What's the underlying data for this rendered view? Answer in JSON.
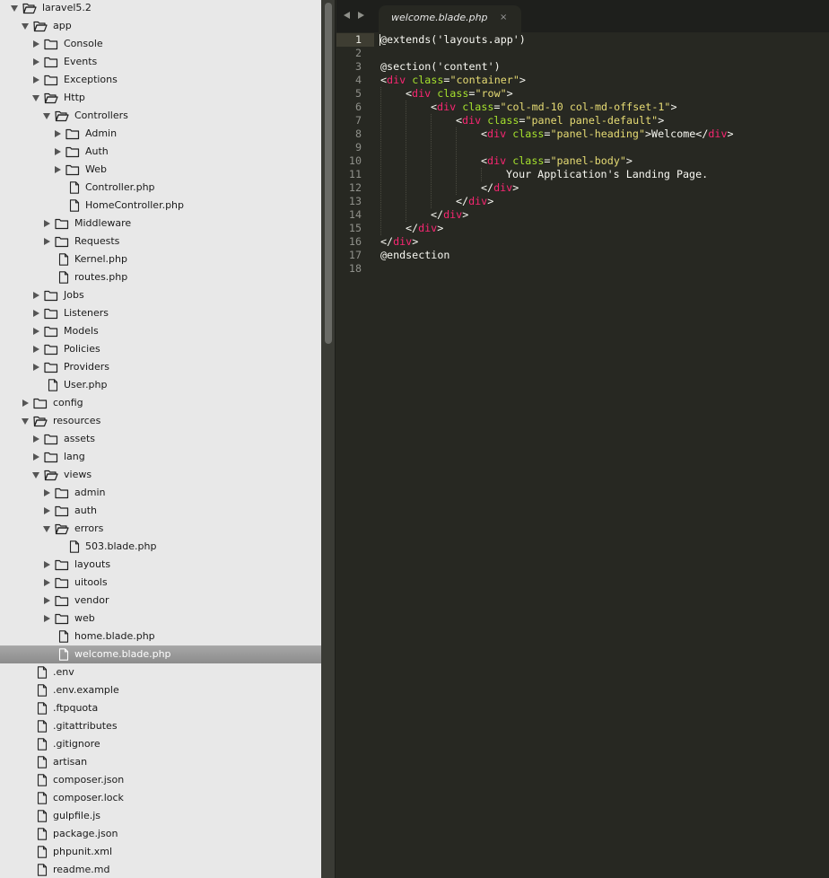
{
  "sidebar": {
    "items": [
      {
        "label": "laravel5.2",
        "depth": 0,
        "type": "folder",
        "open": true
      },
      {
        "label": "app",
        "depth": 1,
        "type": "folder",
        "open": true
      },
      {
        "label": "Console",
        "depth": 2,
        "type": "folder",
        "open": false
      },
      {
        "label": "Events",
        "depth": 2,
        "type": "folder",
        "open": false
      },
      {
        "label": "Exceptions",
        "depth": 2,
        "type": "folder",
        "open": false
      },
      {
        "label": "Http",
        "depth": 2,
        "type": "folder",
        "open": true
      },
      {
        "label": "Controllers",
        "depth": 3,
        "type": "folder",
        "open": true
      },
      {
        "label": "Admin",
        "depth": 4,
        "type": "folder",
        "open": false
      },
      {
        "label": "Auth",
        "depth": 4,
        "type": "folder",
        "open": false
      },
      {
        "label": "Web",
        "depth": 4,
        "type": "folder",
        "open": false
      },
      {
        "label": "Controller.php",
        "depth": 4,
        "type": "file"
      },
      {
        "label": "HomeController.php",
        "depth": 4,
        "type": "file"
      },
      {
        "label": "Middleware",
        "depth": 3,
        "type": "folder",
        "open": false
      },
      {
        "label": "Requests",
        "depth": 3,
        "type": "folder",
        "open": false
      },
      {
        "label": "Kernel.php",
        "depth": 3,
        "type": "file"
      },
      {
        "label": "routes.php",
        "depth": 3,
        "type": "file"
      },
      {
        "label": "Jobs",
        "depth": 2,
        "type": "folder",
        "open": false
      },
      {
        "label": "Listeners",
        "depth": 2,
        "type": "folder",
        "open": false
      },
      {
        "label": "Models",
        "depth": 2,
        "type": "folder",
        "open": false
      },
      {
        "label": "Policies",
        "depth": 2,
        "type": "folder",
        "open": false
      },
      {
        "label": "Providers",
        "depth": 2,
        "type": "folder",
        "open": false
      },
      {
        "label": "User.php",
        "depth": 2,
        "type": "file"
      },
      {
        "label": "config",
        "depth": 1,
        "type": "folder",
        "open": false
      },
      {
        "label": "resources",
        "depth": 1,
        "type": "folder",
        "open": true
      },
      {
        "label": "assets",
        "depth": 2,
        "type": "folder",
        "open": false
      },
      {
        "label": "lang",
        "depth": 2,
        "type": "folder",
        "open": false
      },
      {
        "label": "views",
        "depth": 2,
        "type": "folder",
        "open": true
      },
      {
        "label": "admin",
        "depth": 3,
        "type": "folder",
        "open": false
      },
      {
        "label": "auth",
        "depth": 3,
        "type": "folder",
        "open": false
      },
      {
        "label": "errors",
        "depth": 3,
        "type": "folder",
        "open": true
      },
      {
        "label": "503.blade.php",
        "depth": 4,
        "type": "file"
      },
      {
        "label": "layouts",
        "depth": 3,
        "type": "folder",
        "open": false
      },
      {
        "label": "uitools",
        "depth": 3,
        "type": "folder",
        "open": false
      },
      {
        "label": "vendor",
        "depth": 3,
        "type": "folder",
        "open": false
      },
      {
        "label": "web",
        "depth": 3,
        "type": "folder",
        "open": false
      },
      {
        "label": "home.blade.php",
        "depth": 3,
        "type": "file"
      },
      {
        "label": "welcome.blade.php",
        "depth": 3,
        "type": "file",
        "selected": true
      },
      {
        "label": ".env",
        "depth": 1,
        "type": "file"
      },
      {
        "label": ".env.example",
        "depth": 1,
        "type": "file"
      },
      {
        "label": ".ftpquota",
        "depth": 1,
        "type": "file"
      },
      {
        "label": ".gitattributes",
        "depth": 1,
        "type": "file"
      },
      {
        "label": ".gitignore",
        "depth": 1,
        "type": "file"
      },
      {
        "label": "artisan",
        "depth": 1,
        "type": "file"
      },
      {
        "label": "composer.json",
        "depth": 1,
        "type": "file"
      },
      {
        "label": "composer.lock",
        "depth": 1,
        "type": "file"
      },
      {
        "label": "gulpfile.js",
        "depth": 1,
        "type": "file"
      },
      {
        "label": "package.json",
        "depth": 1,
        "type": "file"
      },
      {
        "label": "phpunit.xml",
        "depth": 1,
        "type": "file"
      },
      {
        "label": "readme.md",
        "depth": 1,
        "type": "file"
      }
    ]
  },
  "tabbar": {
    "active_tab": "welcome.blade.php",
    "close_glyph": "×"
  },
  "editor": {
    "active_line": 1,
    "lines": [
      {
        "n": "1",
        "indent": 0,
        "tokens": [
          [
            "plain",
            "@extends('layouts.app')"
          ]
        ]
      },
      {
        "n": "2",
        "indent": 0,
        "tokens": []
      },
      {
        "n": "3",
        "indent": 0,
        "tokens": [
          [
            "plain",
            "@section('content')"
          ]
        ]
      },
      {
        "n": "4",
        "indent": 0,
        "tokens": [
          [
            "plain",
            "<"
          ],
          [
            "tag",
            "div"
          ],
          [
            "plain",
            " "
          ],
          [
            "attr",
            "class"
          ],
          [
            "plain",
            "="
          ],
          [
            "str",
            "\"container\""
          ],
          [
            "plain",
            ">"
          ]
        ]
      },
      {
        "n": "5",
        "indent": 1,
        "tokens": [
          [
            "plain",
            "<"
          ],
          [
            "tag",
            "div"
          ],
          [
            "plain",
            " "
          ],
          [
            "attr",
            "class"
          ],
          [
            "plain",
            "="
          ],
          [
            "str",
            "\"row\""
          ],
          [
            "plain",
            ">"
          ]
        ]
      },
      {
        "n": "6",
        "indent": 2,
        "tokens": [
          [
            "plain",
            "<"
          ],
          [
            "tag",
            "div"
          ],
          [
            "plain",
            " "
          ],
          [
            "attr",
            "class"
          ],
          [
            "plain",
            "="
          ],
          [
            "str",
            "\"col-md-10 col-md-offset-1\""
          ],
          [
            "plain",
            ">"
          ]
        ]
      },
      {
        "n": "7",
        "indent": 3,
        "tokens": [
          [
            "plain",
            "<"
          ],
          [
            "tag",
            "div"
          ],
          [
            "plain",
            " "
          ],
          [
            "attr",
            "class"
          ],
          [
            "plain",
            "="
          ],
          [
            "str",
            "\"panel panel-default\""
          ],
          [
            "plain",
            ">"
          ]
        ]
      },
      {
        "n": "8",
        "indent": 4,
        "tokens": [
          [
            "plain",
            "<"
          ],
          [
            "tag",
            "div"
          ],
          [
            "plain",
            " "
          ],
          [
            "attr",
            "class"
          ],
          [
            "plain",
            "="
          ],
          [
            "str",
            "\"panel-heading\""
          ],
          [
            "plain",
            ">Welcome</"
          ],
          [
            "tag",
            "div"
          ],
          [
            "plain",
            ">"
          ]
        ]
      },
      {
        "n": "9",
        "indent": 0,
        "tokens": []
      },
      {
        "n": "10",
        "indent": 4,
        "tokens": [
          [
            "plain",
            "<"
          ],
          [
            "tag",
            "div"
          ],
          [
            "plain",
            " "
          ],
          [
            "attr",
            "class"
          ],
          [
            "plain",
            "="
          ],
          [
            "str",
            "\"panel-body\""
          ],
          [
            "plain",
            ">"
          ]
        ]
      },
      {
        "n": "11",
        "indent": 5,
        "tokens": [
          [
            "plain",
            "Your Application's Landing Page."
          ]
        ]
      },
      {
        "n": "12",
        "indent": 4,
        "tokens": [
          [
            "plain",
            "</"
          ],
          [
            "tag",
            "div"
          ],
          [
            "plain",
            ">"
          ]
        ]
      },
      {
        "n": "13",
        "indent": 3,
        "tokens": [
          [
            "plain",
            "</"
          ],
          [
            "tag",
            "div"
          ],
          [
            "plain",
            ">"
          ]
        ]
      },
      {
        "n": "14",
        "indent": 2,
        "tokens": [
          [
            "plain",
            "</"
          ],
          [
            "tag",
            "div"
          ],
          [
            "plain",
            ">"
          ]
        ]
      },
      {
        "n": "15",
        "indent": 1,
        "tokens": [
          [
            "plain",
            "</"
          ],
          [
            "tag",
            "div"
          ],
          [
            "plain",
            ">"
          ]
        ]
      },
      {
        "n": "16",
        "indent": 0,
        "tokens": [
          [
            "plain",
            "</"
          ],
          [
            "tag",
            "div"
          ],
          [
            "plain",
            ">"
          ]
        ]
      },
      {
        "n": "17",
        "indent": 0,
        "tokens": [
          [
            "plain",
            "@endsection"
          ]
        ]
      },
      {
        "n": "18",
        "indent": 0,
        "tokens": []
      }
    ]
  },
  "colors": {
    "tag": "#f92672",
    "attr": "#a6e22e",
    "string": "#e6db74",
    "text": "#f8f8f2",
    "editor_bg": "#272822",
    "sidebar_bg": "#e8e8e8"
  }
}
